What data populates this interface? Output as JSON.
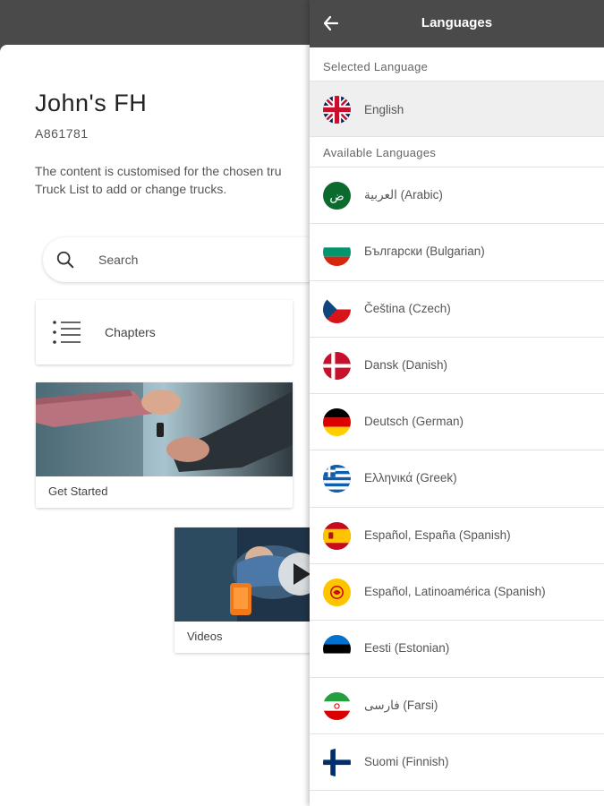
{
  "truck": {
    "name": "John's FH",
    "id": "A861781",
    "description_line1": "The content is customised for the chosen tru",
    "description_line2": "Truck List to add or change trucks."
  },
  "search": {
    "placeholder": "Search"
  },
  "cards": {
    "chapters_label": "Chapters",
    "get_started_label": "Get Started",
    "videos_label": "Videos"
  },
  "panel": {
    "title": "Languages",
    "selected_section_label": "Selected Language",
    "available_section_label": "Available Languages",
    "selected": {
      "label": "English",
      "flag": "uk-flag-icon"
    },
    "languages": [
      {
        "label": "العربية (Arabic)",
        "flag": "arabic-flag-icon"
      },
      {
        "label": "Български (Bulgarian)",
        "flag": "bulgaria-flag-icon"
      },
      {
        "label": "Čeština (Czech)",
        "flag": "czech-flag-icon"
      },
      {
        "label": "Dansk (Danish)",
        "flag": "denmark-flag-icon"
      },
      {
        "label": "Deutsch (German)",
        "flag": "germany-flag-icon"
      },
      {
        "label": "Ελληνικά (Greek)",
        "flag": "greece-flag-icon"
      },
      {
        "label": "Español, España (Spanish)",
        "flag": "spain-flag-icon"
      },
      {
        "label": "Español, Latinoamérica (Spanish)",
        "flag": "latam-flag-icon"
      },
      {
        "label": "Eesti (Estonian)",
        "flag": "estonia-flag-icon"
      },
      {
        "label": "فارسی (Farsi)",
        "flag": "iran-flag-icon"
      },
      {
        "label": "Suomi (Finnish)",
        "flag": "finland-flag-icon"
      }
    ]
  },
  "colors": {
    "header_bg": "#4a4a4a",
    "selected_row_bg": "#efefef",
    "divider": "#e2e2e2"
  }
}
